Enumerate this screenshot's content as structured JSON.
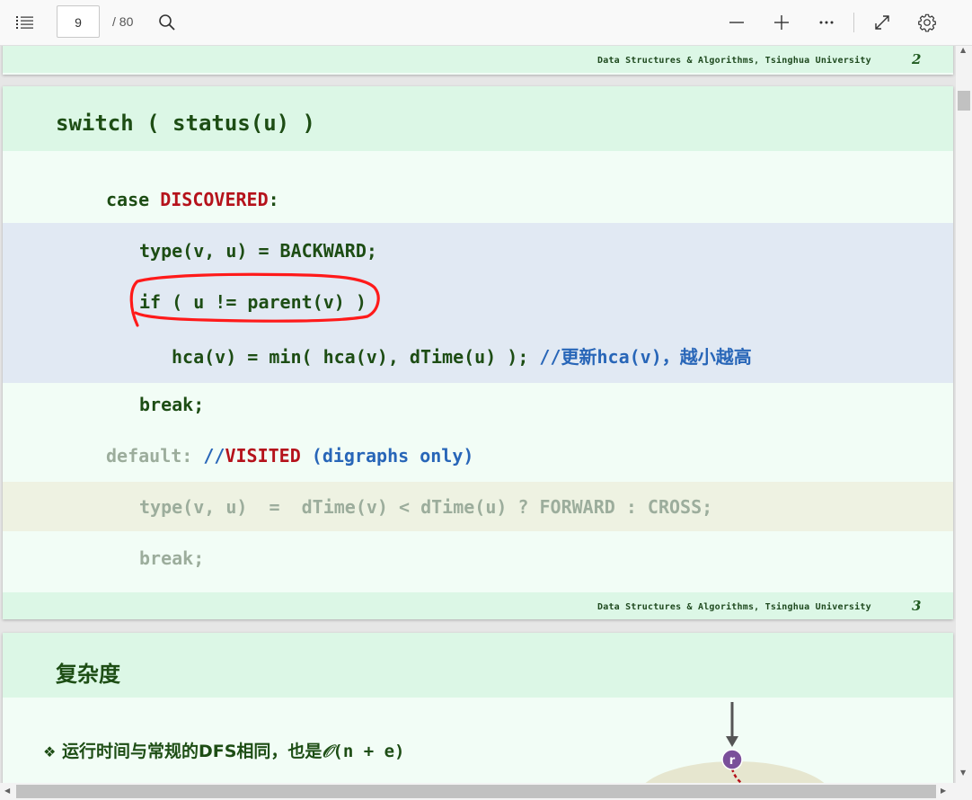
{
  "toolbar": {
    "contents_icon": "table-of-contents-icon",
    "page_current": "9",
    "page_total": "/ 80",
    "search_icon": "search-icon",
    "zoom_out_icon": "minus-icon",
    "zoom_in_icon": "plus-icon",
    "more_icon": "ellipsis-icon",
    "fit_icon": "expand-icon",
    "settings_icon": "gear-icon"
  },
  "footer_label": "Data Structures & Algorithms, Tsinghua University",
  "slide_top": {
    "page_num": "2"
  },
  "slide_code": {
    "title": "switch ( status(u) )",
    "page_num": "3",
    "lines": {
      "case_kw": "case ",
      "case_val": "DISCOVERED",
      "case_colon": ":",
      "type_backward": "type(v, u) = BACKWARD;",
      "if_line": "if ( u != parent(v) )",
      "hca_code": "hca(v) = min( hca(v), dTime(u) ); ",
      "hca_comment": "//更新hca(v)，越小越高",
      "break1": "break;",
      "default_kw": "default: ",
      "default_comment_slashes": "//",
      "default_comment_visited": "VISITED",
      "default_comment_rest": " (digraphs only)",
      "type_forward": "type(v, u)  =  dTime(v) < dTime(u) ? FORWARD : CROSS;",
      "break2": "break;"
    }
  },
  "slide_complexity": {
    "title": "复杂度",
    "bullet_symbol": "❖",
    "bullet_text": "运行时间与常规的DFS相同，也是",
    "bullet_o": "𝒪",
    "bullet_tail": "(n + e)",
    "node_label": "r"
  },
  "colors": {
    "slide_bg": "#f2fdf6",
    "band_bg": "#dcf7e6",
    "code_green": "#1d4d14",
    "keyword_red": "#b5121b",
    "comment_blue": "#2866b8",
    "highlight_blue": "#e1e9f3",
    "highlight_olive": "#eef2e2",
    "annotation_red": "#ff1a1a",
    "node_purple": "#7a4f9a"
  }
}
